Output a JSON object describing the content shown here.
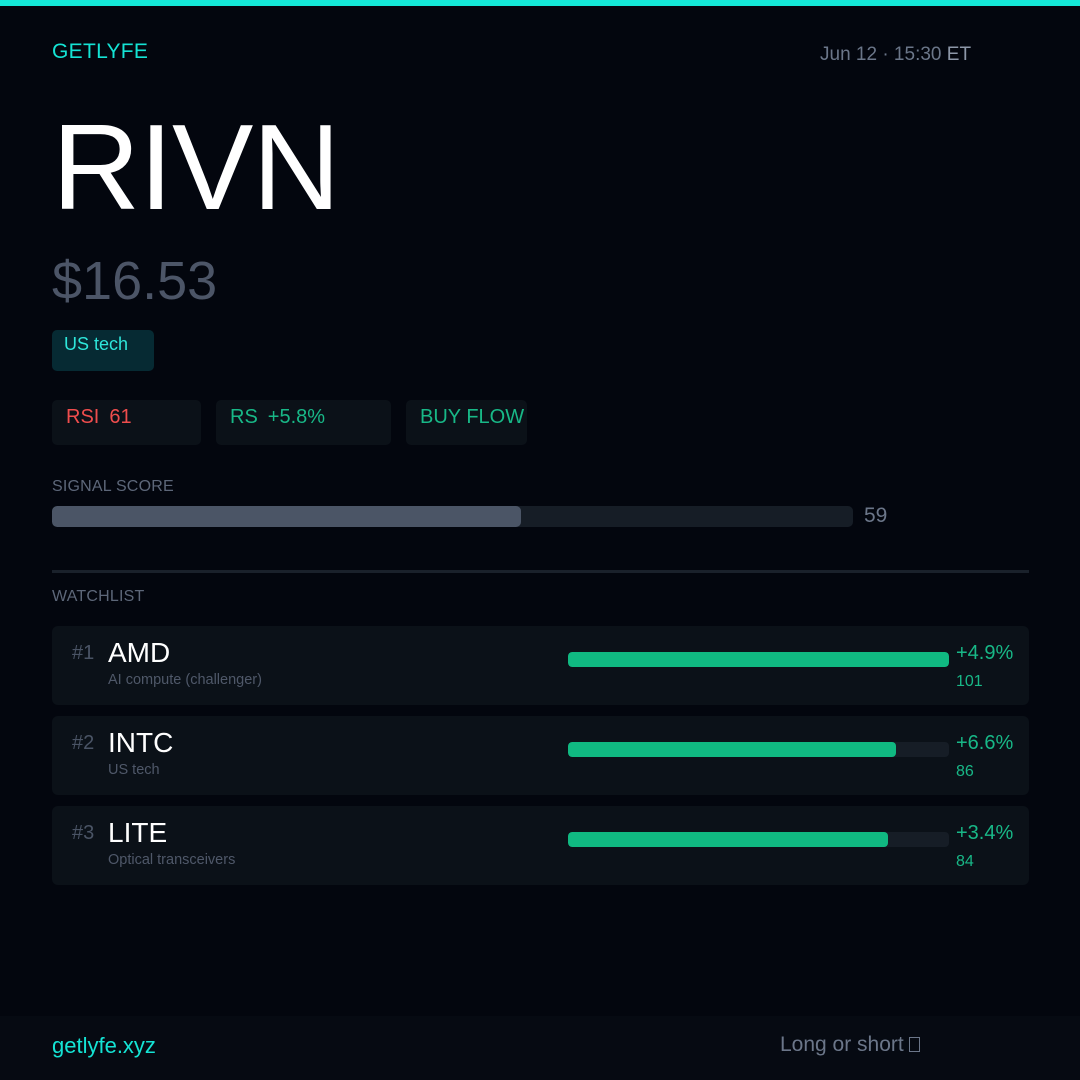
{
  "brand": "GETLYFE",
  "timestamp": {
    "date_time": "Jun 12 · 15:30",
    "tz": "ET"
  },
  "stock": {
    "ticker": "RIVN",
    "price": "$16.53",
    "sector": "US tech"
  },
  "metrics": {
    "rsi_label": "RSI",
    "rsi_value": "61",
    "rs_label": "RS",
    "rs_value": "+5.8%",
    "flow": "BUY FLOW"
  },
  "signal": {
    "label": "SIGNAL SCORE",
    "value": "59",
    "fraction": 0.585
  },
  "watchlist": {
    "label": "WATCHLIST",
    "items": [
      {
        "rank": "#1",
        "symbol": "AMD",
        "description": "AI compute (challenger)",
        "change": "+4.9%",
        "score": "101",
        "bar_fraction": 1.0
      },
      {
        "rank": "#2",
        "symbol": "INTC",
        "description": "US tech",
        "change": "+6.6%",
        "score": "86",
        "bar_fraction": 0.86
      },
      {
        "rank": "#3",
        "symbol": "LITE",
        "description": "Optical transceivers",
        "change": "+3.4%",
        "score": "84",
        "bar_fraction": 0.84
      }
    ]
  },
  "footer": {
    "url": "getlyfe.xyz",
    "tagline": "Long or short"
  },
  "colors": {
    "accent": "#14e3d4",
    "positive": "#18b887",
    "negative": "#ef4d4d",
    "background": "#03060e"
  }
}
